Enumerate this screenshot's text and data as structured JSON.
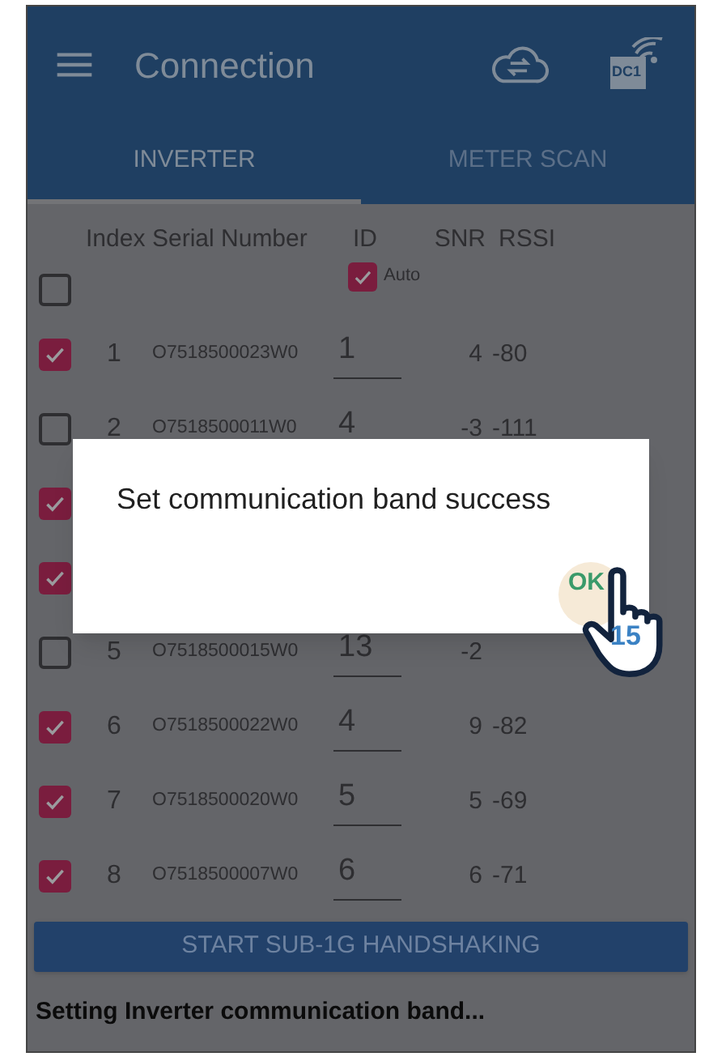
{
  "header": {
    "title": "Connection",
    "device_badge": "DC1"
  },
  "tabs": [
    {
      "label": "INVERTER",
      "selected": true
    },
    {
      "label": "METER SCAN",
      "selected": false
    }
  ],
  "table": {
    "columns": [
      "Index",
      "Serial Number",
      "ID",
      "SNR",
      "RSSI"
    ],
    "select_all": {
      "checked": false
    },
    "auto": {
      "label": "Auto",
      "checked": true
    },
    "rows": [
      {
        "checked": true,
        "index": "1",
        "serial": "O7518500023W0",
        "id": "1",
        "snr": "4",
        "rssi": "-80"
      },
      {
        "checked": false,
        "index": "2",
        "serial": "O7518500011W0",
        "id": "4",
        "snr": "-3",
        "rssi": "-111"
      },
      {
        "checked": true
      },
      {
        "checked": true
      },
      {
        "checked": false,
        "index": "5",
        "serial": "O7518500015W0",
        "id": "13",
        "snr": "-2"
      },
      {
        "checked": true,
        "index": "6",
        "serial": "O7518500022W0",
        "id": "4",
        "snr": "9",
        "rssi": "-82"
      },
      {
        "checked": true,
        "index": "7",
        "serial": "O7518500020W0",
        "id": "5",
        "snr": "5",
        "rssi": "-69"
      },
      {
        "checked": true,
        "index": "8",
        "serial": "O7518500007W0",
        "id": "6",
        "snr": "6",
        "rssi": "-71"
      }
    ]
  },
  "primary_button": "START SUB-1G HANDSHAKING",
  "status": "Setting Inverter communication band...",
  "dialog": {
    "message": "Set communication band success",
    "button": "OK"
  },
  "hint": {
    "step": "15"
  }
}
